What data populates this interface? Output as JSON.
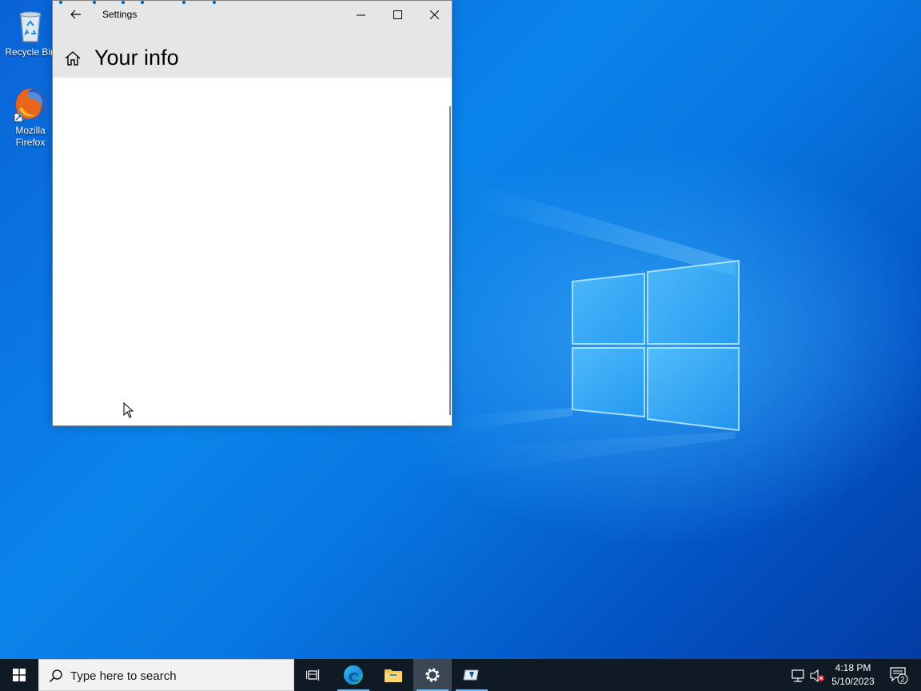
{
  "desktop": {
    "icons": [
      {
        "label": "Recycle Bin",
        "icon": "recycle-bin-icon"
      },
      {
        "label": "Mozilla Firefox",
        "icon": "firefox-icon"
      }
    ]
  },
  "settings_window": {
    "title": "Settings",
    "page_title": "Your info",
    "buttons": {
      "back": "back-arrow-icon",
      "minimize": "minimize-icon",
      "maximize": "maximize-icon",
      "close": "close-icon",
      "home": "home-icon"
    }
  },
  "taskbar": {
    "search_placeholder": "Type here to search",
    "apps": [
      {
        "name": "Task View",
        "icon": "task-view-icon"
      },
      {
        "name": "Microsoft Edge",
        "icon": "edge-icon"
      },
      {
        "name": "File Explorer",
        "icon": "file-explorer-icon"
      },
      {
        "name": "Settings",
        "icon": "gear-icon",
        "active": true
      },
      {
        "name": "App",
        "icon": "app-icon"
      }
    ],
    "clock": {
      "time": "4:18 PM",
      "date": "5/10/2023"
    },
    "notification_count": "2"
  },
  "colors": {
    "desktop_blue": "#0a84ea",
    "taskbar": "#101a24",
    "titlebar": "#e6e6e6",
    "accent": "#0063b1"
  }
}
